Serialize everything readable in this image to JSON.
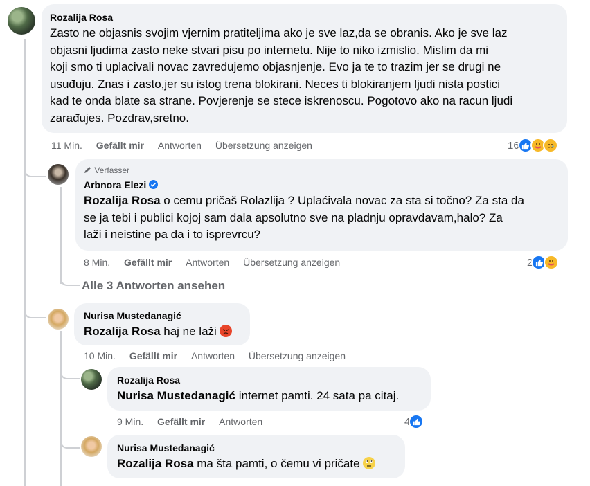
{
  "comments": [
    {
      "author": "Rozalija Rosa",
      "text": "Zasto ne objasnis svojim vjernim pratiteljima ako je sve laz,da se obranis. Ako je sve laz objasni ljudima zasto neke stvari pisu po internetu. Nije to niko izmislio. Mislim da mi koji smo ti uplacivali novac zavredujemo objasnjenje. Evo ja te to trazim jer se drugi ne usuđuju. Znas i zasto,jer su istog trena blokirani. Neces ti blokiranjem ljudi nista postici kad te onda blate sa strane. Povjerenje se stece iskrenoscu. Pogotovo ako na racun ljudi zarađujes. Pozdrav,sretno.",
      "lines": [
        "Zasto ne objasnis svojim vjernim pratiteljima ako je sve laz,da se obranis. Ako je sve laz",
        "objasni ljudima zasto neke stvari pisu po internetu. Nije to niko izmislio. Mislim da mi",
        "koji smo ti uplacivali novac zavredujemo objasnjenje. Evo ja te to trazim jer se drugi ne",
        "usuđuju. Znas i zasto,jer su istog trena blokirani. Neces ti blokiranjem ljudi nista postici",
        "kad te onda blate sa strane. Povjerenje se stece iskrenoscu. Pogotovo ako na racun ljudi",
        "zarađujes. Pozdrav,sretno."
      ],
      "time": "11 Min.",
      "like": "Gefällt mir",
      "reply": "Antworten",
      "translate": "Übersetzung anzeigen",
      "reactions_count": "16",
      "reaction_icons": [
        "like-icon",
        "care-icon",
        "sad-icon"
      ]
    },
    {
      "badge": "Verfasser",
      "author": "Arbnora Elezi",
      "verified": true,
      "mention": "Rozalija Rosa",
      "lines": [
        " o cemu pričaš Rolazlija ? Uplaćivala novac za sta si točno? Za sta da",
        "se ja tebi i publici kojoj sam dala apsolutno sve na pladnju opravdavam,halo? Za",
        "laži i neistine pa da i to isprevrcu?"
      ],
      "time": "8 Min.",
      "like": "Gefällt mir",
      "reply": "Antworten",
      "translate": "Übersetzung anzeigen",
      "reactions_count": "2",
      "reaction_icons": [
        "like-icon",
        "care-icon"
      ]
    },
    {
      "view_replies": "Alle 3 Antworten ansehen"
    },
    {
      "author": "Nurisa Mustedanagić",
      "mention": "Rozalija Rosa",
      "text": " haj ne laži",
      "emoji": "angry-face-icon",
      "time": "10 Min.",
      "like": "Gefällt mir",
      "reply": "Antworten",
      "translate": "Übersetzung anzeigen"
    },
    {
      "author": "Rozalija Rosa",
      "mention": "Nurisa Mustedanagić",
      "text": " internet pamti. 24 sata pa citaj.",
      "time": "9 Min.",
      "like": "Gefällt mir",
      "reply": "Antworten",
      "reactions_count": "4",
      "reaction_icons": [
        "like-icon"
      ]
    },
    {
      "author": "Nurisa Mustedanagić",
      "mention": "Rozalija Rosa",
      "text": " ma šta pamti, o čemu vi pričate",
      "emoji": "eye-roll-face-icon"
    }
  ],
  "colors": {
    "bubble": "#f0f2f5",
    "meta": "#65676b",
    "like": "#1877f2",
    "thread_line": "#ced0d4"
  }
}
